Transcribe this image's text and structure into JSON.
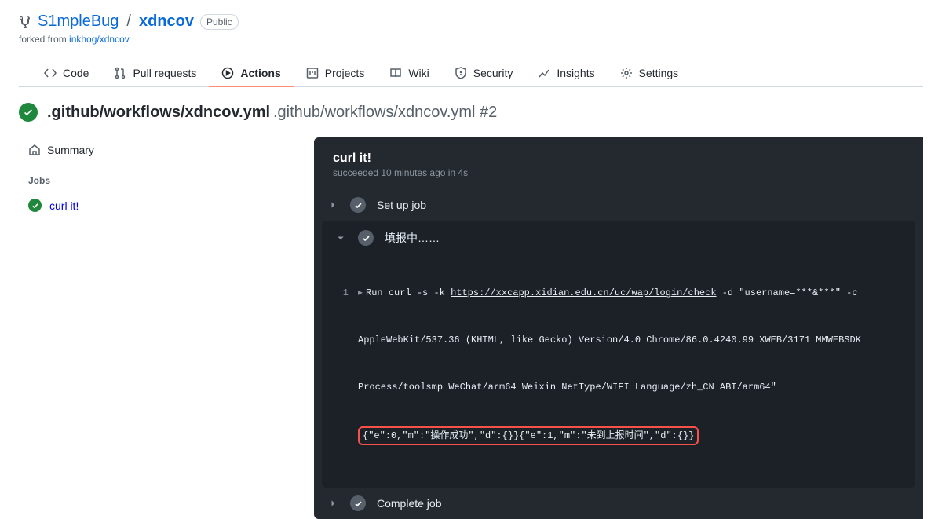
{
  "repo": {
    "owner": "S1mpleBug",
    "name": "xdncov",
    "visibility": "Public",
    "forked_prefix": "forked from ",
    "forked_from": "inkhog/xdncov"
  },
  "nav": {
    "code": "Code",
    "pulls": "Pull requests",
    "actions": "Actions",
    "projects": "Projects",
    "wiki": "Wiki",
    "security": "Security",
    "insights": "Insights",
    "settings": "Settings"
  },
  "workflow": {
    "file": ".github/workflows/xdncov.yml",
    "subtitle": ".github/workflows/xdncov.yml #2"
  },
  "sidebar": {
    "summary": "Summary",
    "jobs_heading": "Jobs",
    "job_name": "curl it!"
  },
  "job": {
    "title": "curl it!",
    "status_line": "succeeded 10 minutes ago in 4s"
  },
  "steps": {
    "setup": "Set up job",
    "main": "填报中……",
    "complete": "Complete job"
  },
  "log": {
    "lineno1": "1",
    "run_prefix": "Run curl -s -k ",
    "url": "https://xxcapp.xidian.edu.cn/uc/wap/login/check",
    "run_suffix": " -d \"username=***&***\" -c",
    "line2": "AppleWebKit/537.36 (KHTML, like Gecko) Version/4.0 Chrome/86.0.4240.99 XWEB/3171 MMWEBSDK",
    "line3": "Process/toolsmp WeChat/arm64 Weixin NetType/WIFI Language/zh_CN ABI/arm64\"",
    "line4": "{\"e\":0,\"m\":\"操作成功\",\"d\":{}}{\"e\":1,\"m\":\"未到上报时间\",\"d\":{}}"
  }
}
